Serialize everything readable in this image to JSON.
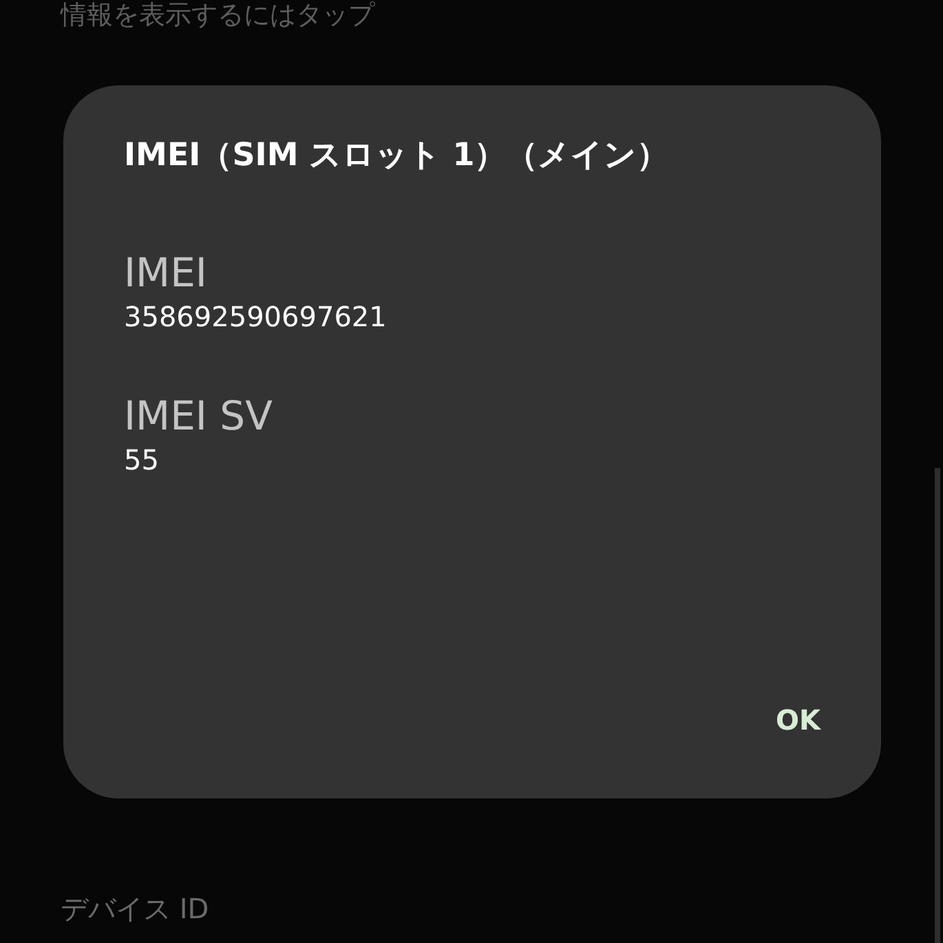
{
  "background": {
    "hint": "情報を表示するにはタップ",
    "bottom_label": "デバイス ID"
  },
  "dialog": {
    "title": "IMEI（SIM スロット 1）（メイン）",
    "fields": [
      {
        "label": "IMEI",
        "value": "358692590697621"
      },
      {
        "label": "IMEI SV",
        "value": "55"
      }
    ],
    "button": "OK"
  }
}
